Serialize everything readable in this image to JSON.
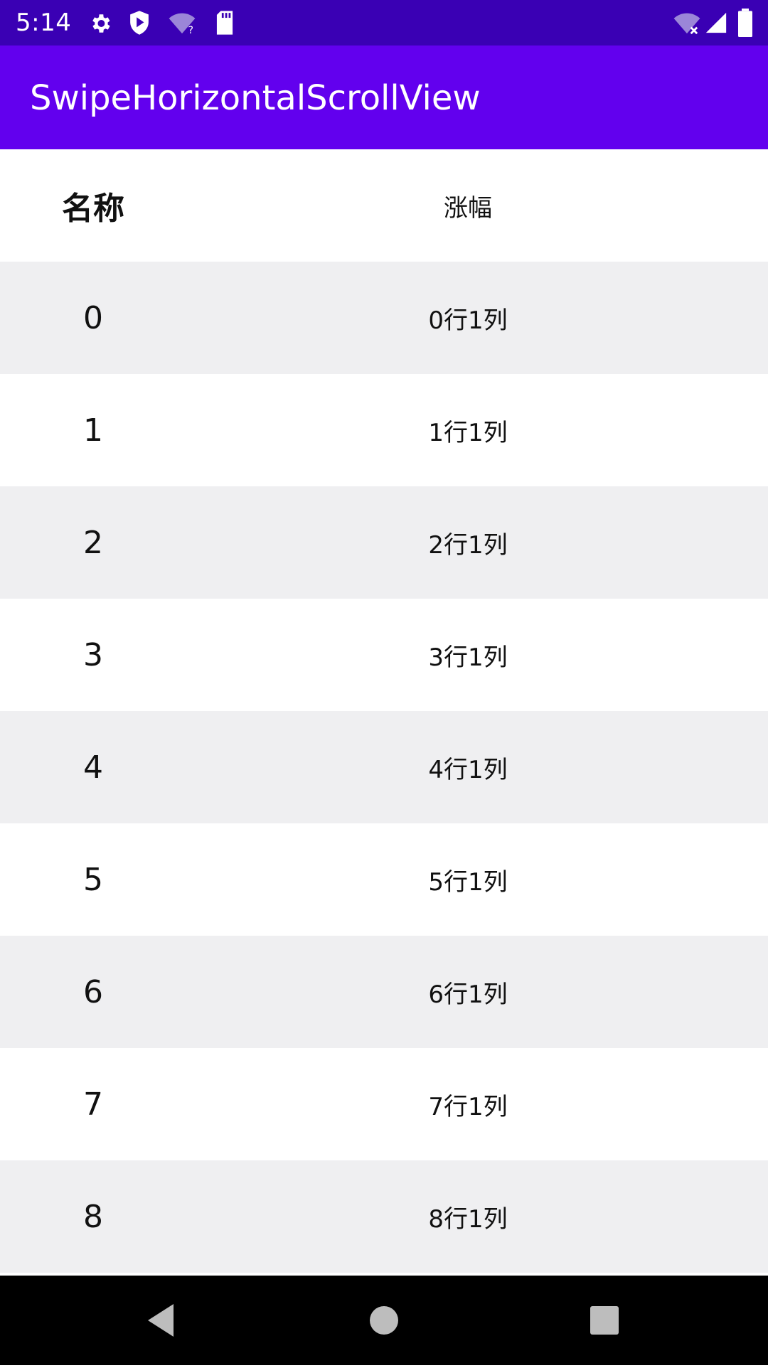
{
  "status_bar": {
    "time": "5:14",
    "left_icons": [
      "gear-icon",
      "shield-play-icon",
      "wifi-unknown-icon",
      "sd-card-icon"
    ],
    "right_icons": [
      "wifi-off-icon",
      "cell-signal-icon",
      "battery-icon"
    ]
  },
  "app_bar": {
    "title": "SwipeHorizontalScrollView"
  },
  "table": {
    "header": {
      "name": "名称",
      "change": "涨幅"
    },
    "rows": [
      {
        "name": "0",
        "value": "0行1列"
      },
      {
        "name": "1",
        "value": "1行1列"
      },
      {
        "name": "2",
        "value": "2行1列"
      },
      {
        "name": "3",
        "value": "3行1列"
      },
      {
        "name": "4",
        "value": "4行1列"
      },
      {
        "name": "5",
        "value": "5行1列"
      },
      {
        "name": "6",
        "value": "6行1列"
      },
      {
        "name": "7",
        "value": "7行1列"
      },
      {
        "name": "8",
        "value": "8行1列"
      }
    ]
  },
  "nav_bar": {
    "buttons": [
      "back-icon",
      "home-icon",
      "recents-icon"
    ]
  },
  "colors": {
    "status_bar": "#3a00b4",
    "app_bar": "#6200ee",
    "row_alt": "#efeff1",
    "nav_bar": "#000000"
  }
}
